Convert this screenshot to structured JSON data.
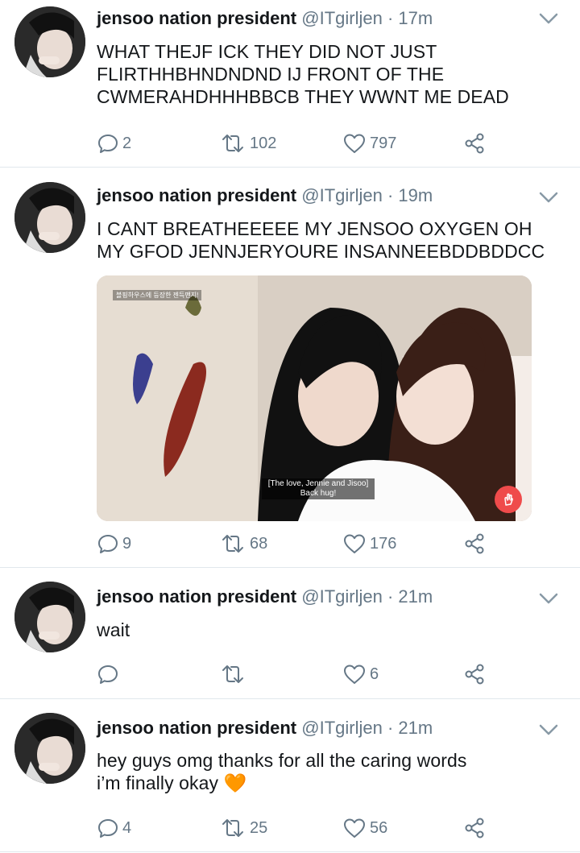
{
  "tweets": [
    {
      "name": "jensoo nation president",
      "handle": "@ITgirljen",
      "time": "· 17m",
      "text": "WHAT THEJF ICK THEY DID NOT JUST FLIRTHHBHNDNDND IJ FRONT OF THE CWMERAHDHHHBBCB THEY WWNT ME DEAD",
      "replies": "2",
      "retweets": "102",
      "likes": "797"
    },
    {
      "name": "jensoo nation president",
      "handle": "@ITgirljen",
      "time": "· 19m",
      "text": "I CANT BREATHEEEEE MY JENSOO OXYGEN OH MY GFOD JENNJERYOURE INSANNEEBDDBDDCC",
      "replies": "9",
      "retweets": "68",
      "likes": "176",
      "media": {
        "caption": "[The love, Jennie and Jisoo] Back hug!",
        "watermark": "블핑하우스에 등장한 젠득맨지!"
      }
    },
    {
      "name": "jensoo nation president",
      "handle": "@ITgirljen",
      "time": "· 21m",
      "text": "wait",
      "replies": "",
      "retweets": "",
      "likes": "6"
    },
    {
      "name": "jensoo nation president",
      "handle": "@ITgirljen",
      "time": "· 21m",
      "text": "hey guys omg thanks for all the caring words i’m finally okay 🧡",
      "replies": "4",
      "retweets": "25",
      "likes": "56"
    }
  ],
  "icons": {
    "reply": "reply-icon",
    "retweet": "retweet-icon",
    "like": "heart-icon",
    "share": "share-icon",
    "more": "chevron-down-icon"
  },
  "colors": {
    "text": "#14171a",
    "secondary": "#657786",
    "divider": "#e1e8ed",
    "badge": "#ef4b4b"
  }
}
